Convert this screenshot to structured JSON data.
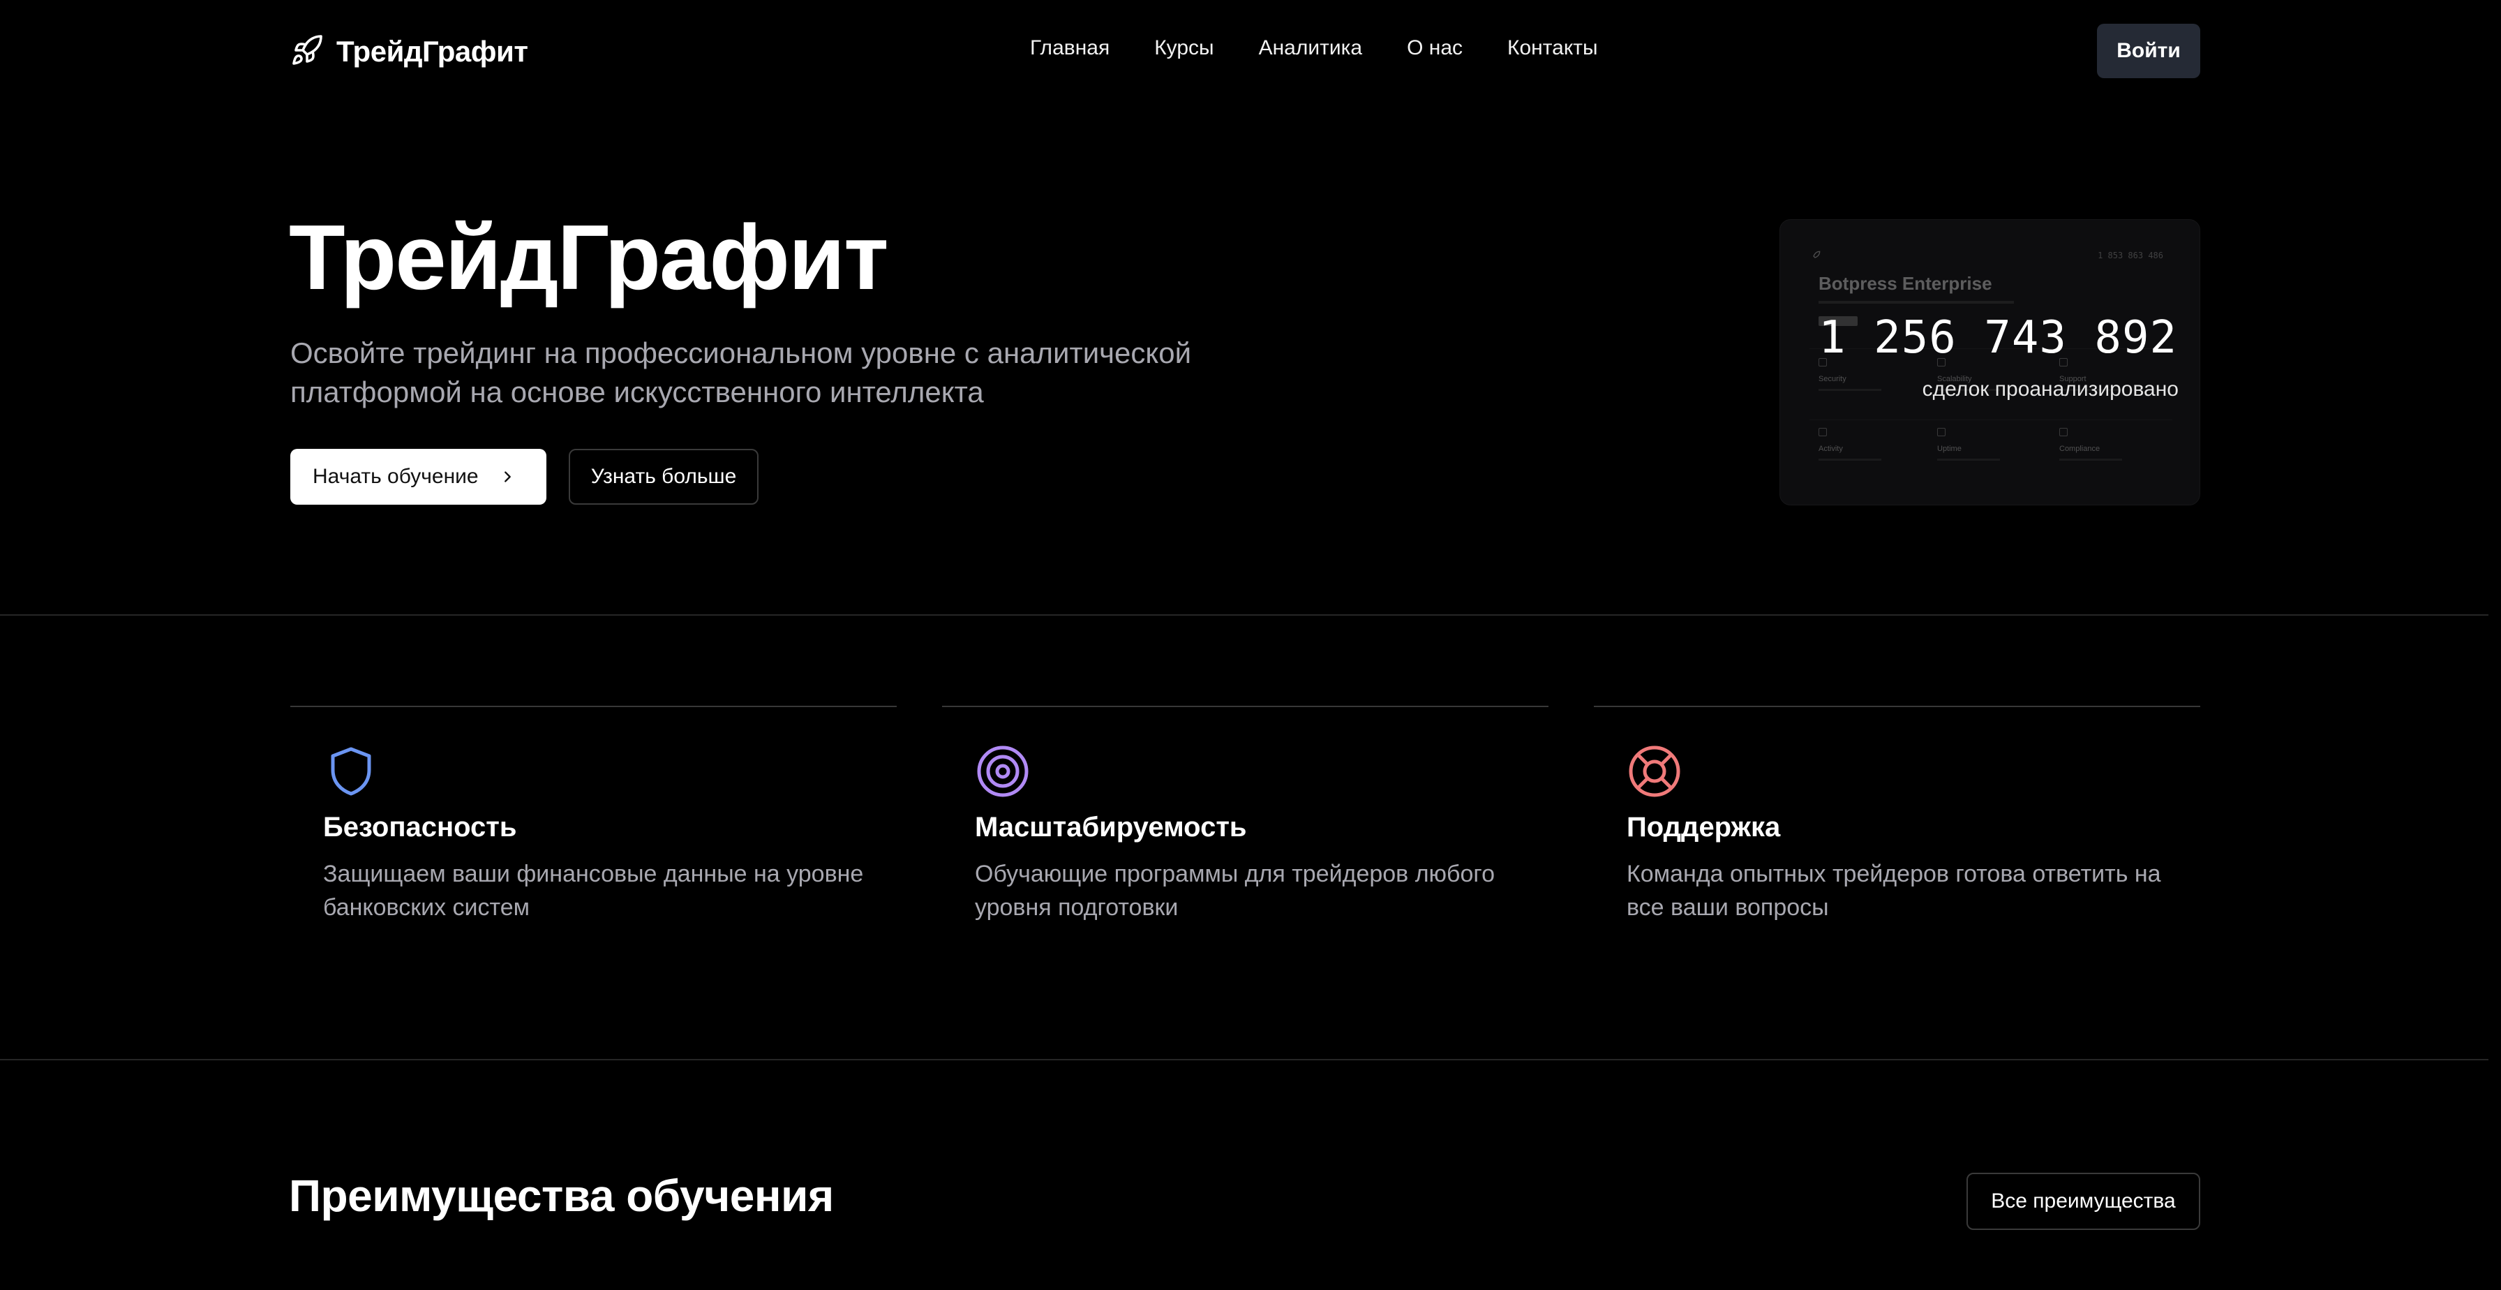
{
  "brand": {
    "name": "ТрейдГрафит",
    "icon": "rocket-icon"
  },
  "nav": {
    "items": [
      "Главная",
      "Курсы",
      "Аналитика",
      "О нас",
      "Контакты"
    ],
    "login_label": "Войти"
  },
  "hero": {
    "title": "ТрейдГрафит",
    "subtitle": "Освойте трейдинг на профессиональном уровне с аналитической платформой на основе искусственного интеллекта",
    "primary_button": "Начать обучение",
    "secondary_button": "Узнать больше",
    "card": {
      "preview_title": "Botpress Enterprise",
      "preview_number": "1 853 863 486",
      "preview_labels": [
        "Security",
        "Scalability",
        "Support",
        "Activity",
        "Uptime",
        "Compliance"
      ],
      "counter": "1 256 743 892",
      "counter_label": "сделок проанализировано"
    }
  },
  "features": [
    {
      "icon": "shield-icon",
      "color": "#6b95f2",
      "title": "Безопасность",
      "text": "Защищаем ваши финансовые данные на уровне банковских систем"
    },
    {
      "icon": "target-icon",
      "color": "#b18af5",
      "title": "Масштабируемость",
      "text": "Обучающие программы для трейдеров любого уровня подготовки"
    },
    {
      "icon": "lifebuoy-icon",
      "color": "#f07a7a",
      "title": "Поддержка",
      "text": "Команда опытных трейдеров готова ответить на все ваши вопросы"
    }
  ],
  "benefits": {
    "title": "Преимущества обучения",
    "all_button": "Все преимущества"
  },
  "colors": {
    "background": "#000000",
    "login_bg": "#252a35",
    "muted_text": "#a8a8b0"
  }
}
